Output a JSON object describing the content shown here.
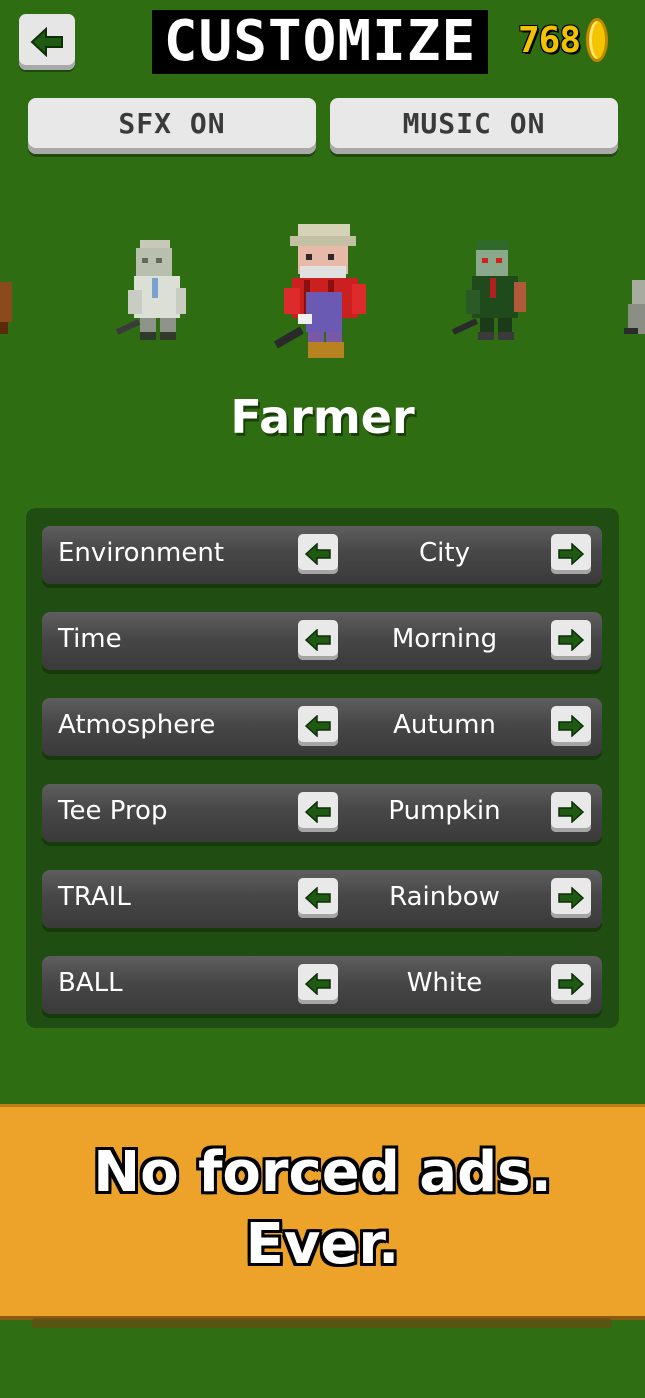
{
  "header": {
    "title": "CUSTOMIZE",
    "coins": "768",
    "back_icon": "arrow-left-icon",
    "coin_icon": "coin-icon"
  },
  "toggles": {
    "sfx_label": "SFX ON",
    "music_label": "MUSIC ON"
  },
  "character": {
    "selected_name": "Farmer"
  },
  "settings": [
    {
      "label": "Environment",
      "value": "City"
    },
    {
      "label": "Time",
      "value": "Morning"
    },
    {
      "label": "Atmosphere",
      "value": "Autumn"
    },
    {
      "label": "Tee Prop",
      "value": "Pumpkin"
    },
    {
      "label": "TRAIL",
      "value": "Rainbow"
    },
    {
      "label": "BALL",
      "value": "White"
    }
  ],
  "promo": {
    "line1": "No forced ads.",
    "line2": "Ever."
  },
  "colors": {
    "background": "#2f6d12",
    "panel": "#1f4d12",
    "banner": "#eda32a",
    "coin": "#f2c200",
    "arrow": "#1f5a12"
  }
}
